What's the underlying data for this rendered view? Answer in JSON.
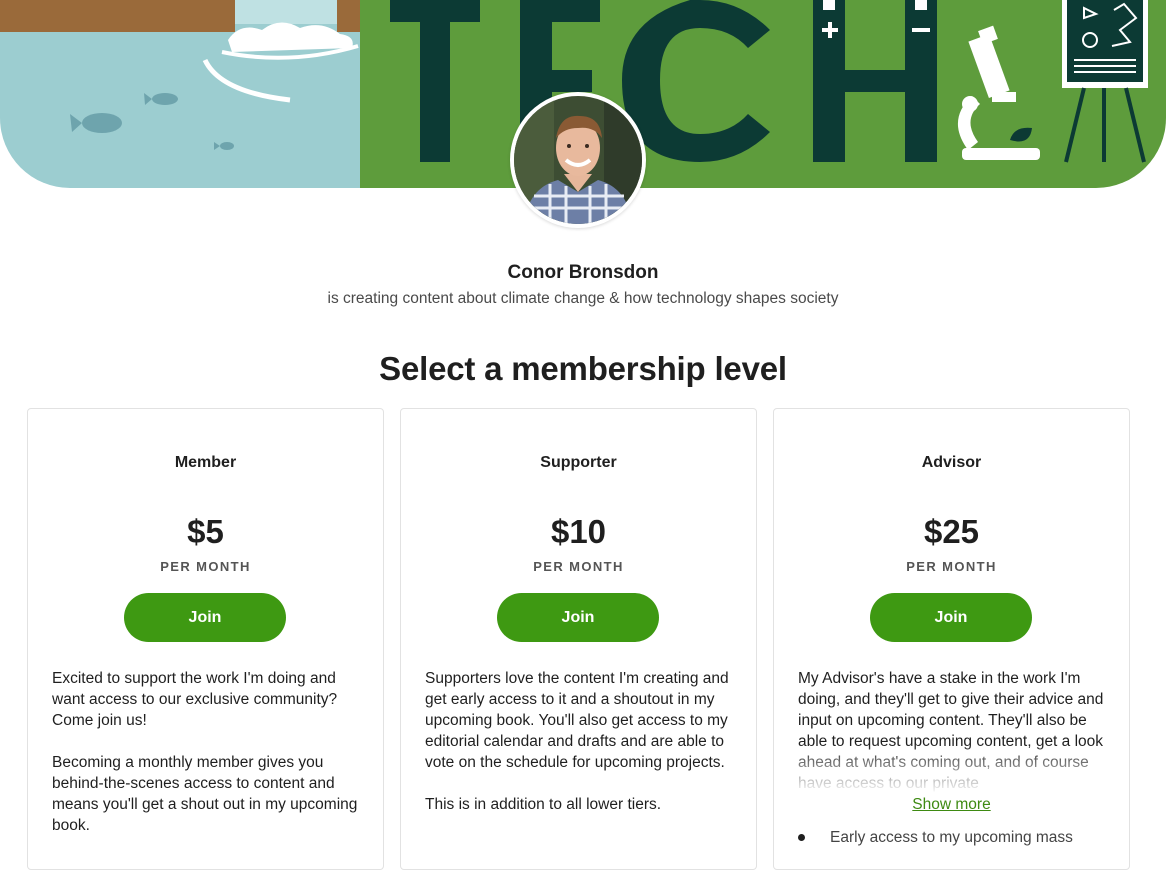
{
  "banner": {
    "word": "TECH",
    "battery_plus": "+",
    "battery_minus": "−",
    "colors": {
      "water": "#9ccdd0",
      "green": "#5e9c3c",
      "dark": "#0c3a34",
      "wood": "#9a6a3a"
    }
  },
  "creator": {
    "name": "Conor Bronsdon",
    "tagline": "is creating content about climate change & how technology shapes society"
  },
  "section_title": "Select a membership level",
  "tiers": [
    {
      "name": "Member",
      "price": "$5",
      "period": "PER MONTH",
      "join_label": "Join",
      "description": [
        "Excited to support the work I'm doing and want access to our exclusive community? Come join us!",
        "Becoming a monthly member gives you behind-the-scenes access to content and means you'll get a shout out in my upcoming book."
      ]
    },
    {
      "name": "Supporter",
      "price": "$10",
      "period": "PER MONTH",
      "join_label": "Join",
      "description": [
        "Supporters love the content I'm creating and get early access to it and a shoutout in my upcoming book. You'll also get access to my editorial calendar and drafts and are able to vote on the schedule for upcoming projects.",
        "This is in addition to all lower tiers."
      ]
    },
    {
      "name": "Advisor",
      "price": "$25",
      "period": "PER MONTH",
      "join_label": "Join",
      "description": [
        "My Advisor's have a stake in the work I'm doing, and they'll get to give their advice and input on upcoming content. They'll also be able to request upcoming content, get a look ahead at what's coming out, and of course have access to our private"
      ],
      "show_more": "Show more",
      "benefits": [
        "Early access to my upcoming mass"
      ]
    }
  ],
  "accent_color": "#3e9912"
}
